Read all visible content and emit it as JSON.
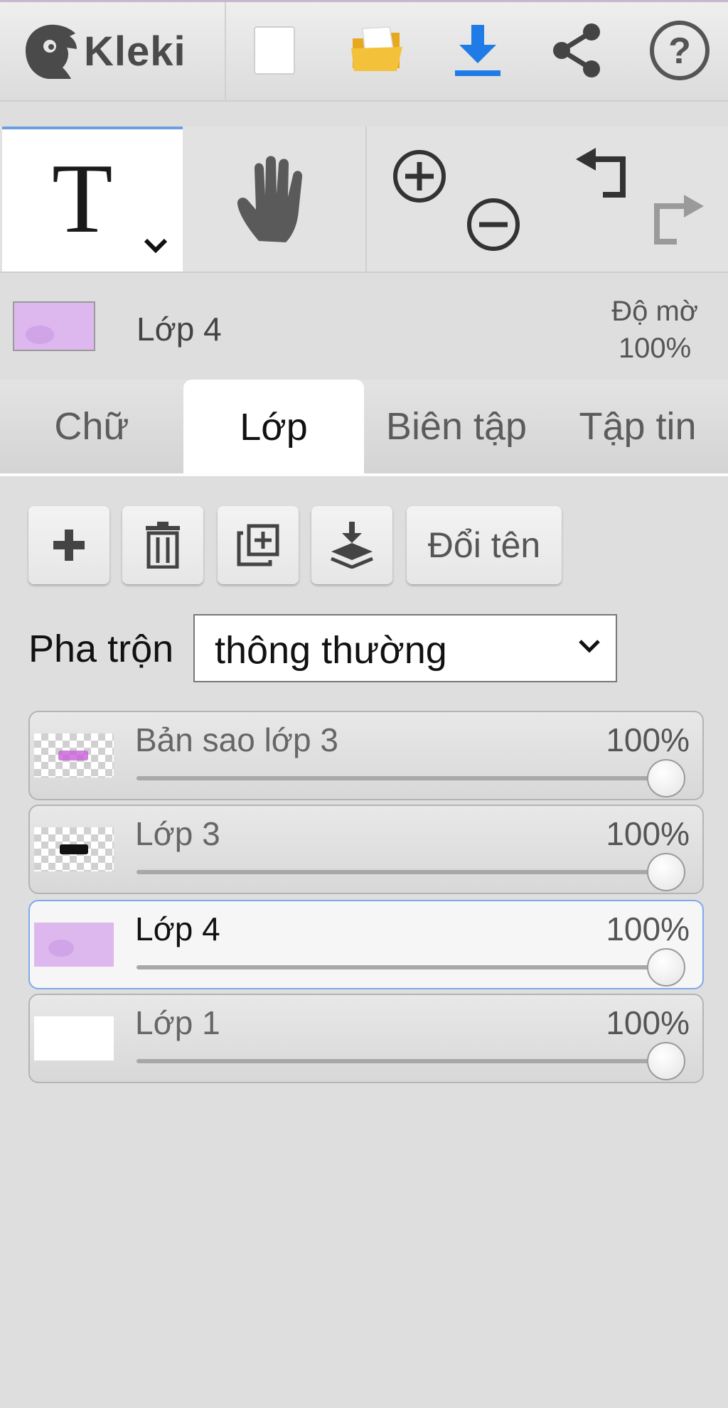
{
  "header": {
    "logo_text": "Kleki",
    "buttons": [
      {
        "name": "new-image-button",
        "icon": "new-document-icon"
      },
      {
        "name": "open-image-button",
        "icon": "folder-icon"
      },
      {
        "name": "save-image-button",
        "icon": "download-icon"
      },
      {
        "name": "share-button",
        "icon": "share-icon"
      },
      {
        "name": "help-button",
        "icon": "help-icon"
      }
    ]
  },
  "tools": {
    "text_tool_glyph": "T",
    "hand_tool_icon": "hand-icon",
    "zoom_in_icon": "zoom-in-icon",
    "zoom_out_icon": "zoom-out-icon",
    "undo_icon": "undo-icon",
    "redo_icon": "redo-icon"
  },
  "layer_info": {
    "current_layer": "Lớp 4",
    "opacity_label": "Độ mờ",
    "opacity_value": "100%"
  },
  "tabs": [
    {
      "label": "Chữ",
      "active": false
    },
    {
      "label": "Lớp",
      "active": true
    },
    {
      "label": "Biên tập",
      "active": false
    },
    {
      "label": "Tập tin",
      "active": false
    }
  ],
  "layers_panel": {
    "add_icon": "plus-icon",
    "delete_icon": "trash-icon",
    "duplicate_icon": "duplicate-icon",
    "merge_icon": "merge-down-icon",
    "rename_label": "Đổi tên",
    "blend_label": "Pha trộn",
    "blend_value": "thông thường",
    "layers": [
      {
        "name": "Bản sao lớp 3",
        "opacity": "100%",
        "opacity_fraction": 1.0,
        "selected": false
      },
      {
        "name": "Lớp 3",
        "opacity": "100%",
        "opacity_fraction": 1.0,
        "selected": false
      },
      {
        "name": "Lớp 4",
        "opacity": "100%",
        "opacity_fraction": 1.0,
        "selected": true
      },
      {
        "name": "Lớp 1",
        "opacity": "100%",
        "opacity_fraction": 1.0,
        "selected": false
      }
    ]
  },
  "colors": {
    "accent": "#3a86e6",
    "active_tab_bg": "#ffffff",
    "selected_layer_border": "#7fa8ef",
    "layer4_color": "#dcb8ee"
  }
}
